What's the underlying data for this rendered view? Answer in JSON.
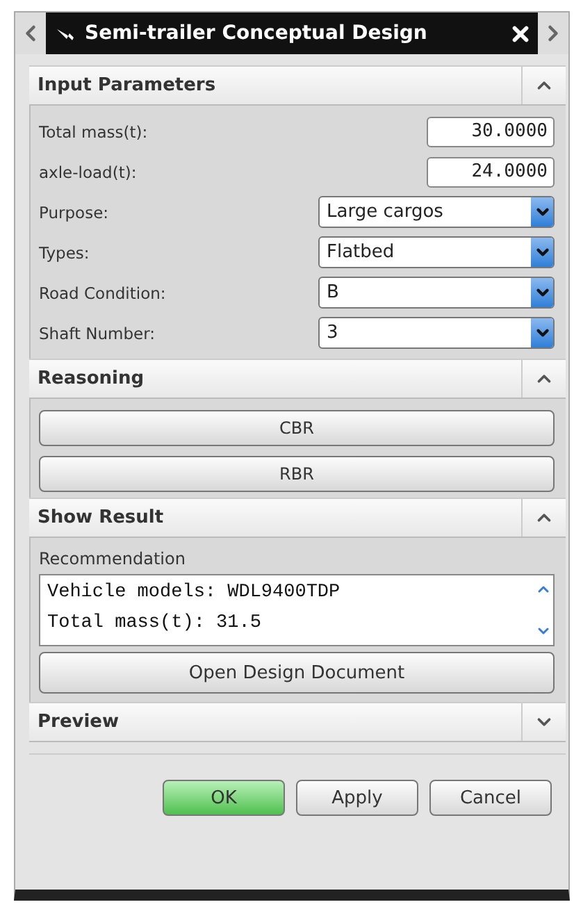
{
  "window": {
    "title": "Semi-trailer Conceptual Design"
  },
  "sections": [
    {
      "kind": "inputs",
      "title": "Input Parameters",
      "expanded": true,
      "fields": [
        {
          "kind": "number",
          "label": "Total mass(t):",
          "value": "30.0000"
        },
        {
          "kind": "number",
          "label": "axle-load(t):",
          "value": "24.0000"
        },
        {
          "kind": "select",
          "label": "Purpose:",
          "value": "Large cargos"
        },
        {
          "kind": "select",
          "label": "Types:",
          "value": "Flatbed"
        },
        {
          "kind": "select",
          "label": "Road Condition:",
          "value": "B"
        },
        {
          "kind": "select",
          "label": "Shaft Number:",
          "value": "3"
        }
      ]
    },
    {
      "kind": "buttons",
      "title": "Reasoning",
      "expanded": true,
      "buttons": [
        "CBR",
        "RBR"
      ]
    },
    {
      "kind": "result",
      "title": "Show Result",
      "expanded": true,
      "label": "Recommendation",
      "lines": [
        "Vehicle models: WDL9400TDP",
        "Total mass(t): 31.5"
      ],
      "button": "Open Design Document"
    },
    {
      "title": "Preview",
      "expanded": false
    }
  ],
  "actions": [
    {
      "label": "OK",
      "primary": true
    },
    {
      "label": "Apply",
      "primary": false
    },
    {
      "label": "Cancel",
      "primary": false
    }
  ]
}
